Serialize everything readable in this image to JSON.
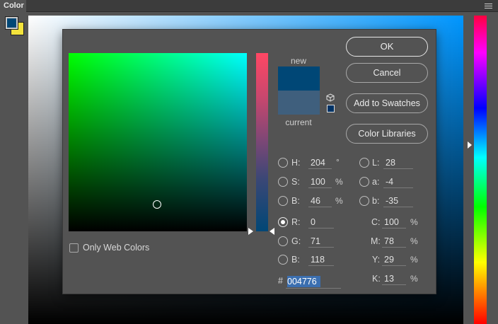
{
  "panel": {
    "tab_label": "Color"
  },
  "colors": {
    "foreground": "#004776",
    "background": "#f3e33c",
    "new": "#004776",
    "current": "#3f5f7d",
    "websafe": "#003366"
  },
  "picker": {
    "labels": {
      "new": "new",
      "current": "current"
    },
    "buttons": {
      "ok": "OK",
      "cancel": "Cancel",
      "add_swatches": "Add to Swatches",
      "libraries": "Color Libraries"
    },
    "only_web_colors": {
      "label": "Only Web Colors",
      "checked": false
    },
    "hsb": {
      "h": {
        "label": "H:",
        "value": "204",
        "unit": "°"
      },
      "s": {
        "label": "S:",
        "value": "100",
        "unit": "%"
      },
      "b": {
        "label": "B:",
        "value": "46",
        "unit": "%"
      }
    },
    "rgb": {
      "r": {
        "label": "R:",
        "value": "0"
      },
      "g": {
        "label": "G:",
        "value": "71"
      },
      "b": {
        "label": "B:",
        "value": "118"
      }
    },
    "lab": {
      "l": {
        "label": "L:",
        "value": "28"
      },
      "a": {
        "label": "a:",
        "value": "-4"
      },
      "b": {
        "label": "b:",
        "value": "-35"
      }
    },
    "cmyk": {
      "c": {
        "label": "C:",
        "value": "100",
        "unit": "%"
      },
      "m": {
        "label": "M:",
        "value": "78",
        "unit": "%"
      },
      "y": {
        "label": "Y:",
        "value": "29",
        "unit": "%"
      },
      "k": {
        "label": "K:",
        "value": "13",
        "unit": "%"
      }
    },
    "hex": {
      "label": "#",
      "value": "004776"
    },
    "selected_channel": "R"
  }
}
